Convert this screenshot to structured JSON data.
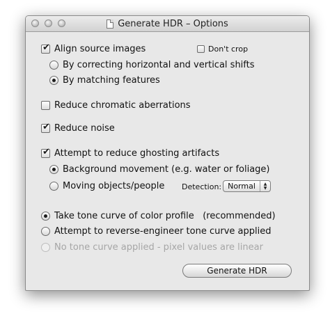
{
  "window": {
    "title": "Generate HDR – Options"
  },
  "align": {
    "label": "Align source images",
    "checked": true,
    "dont_crop_label": "Don't crop",
    "dont_crop_checked": false,
    "options": [
      {
        "label": "By correcting horizontal and vertical shifts",
        "selected": false
      },
      {
        "label": "By matching features",
        "selected": true
      }
    ]
  },
  "chromatic": {
    "label": "Reduce chromatic aberrations",
    "checked": false
  },
  "noise": {
    "label": "Reduce noise",
    "checked": true
  },
  "ghosting": {
    "label": "Attempt to reduce ghosting artifacts",
    "checked": true,
    "options": [
      {
        "label": "Background movement (e.g. water or foliage)",
        "selected": true
      },
      {
        "label": "Moving objects/people",
        "selected": false
      }
    ],
    "detection_label": "Detection:",
    "detection_value": "Normal"
  },
  "tone_curve": {
    "options": [
      {
        "label": "Take tone curve of color profile   (recommended)",
        "selected": true,
        "enabled": true
      },
      {
        "label": "Attempt to reverse-engineer tone curve applied",
        "selected": false,
        "enabled": true
      },
      {
        "label": "No tone curve applied - pixel values are linear",
        "selected": false,
        "enabled": false
      }
    ]
  },
  "buttons": {
    "generate_label": "Generate HDR"
  }
}
